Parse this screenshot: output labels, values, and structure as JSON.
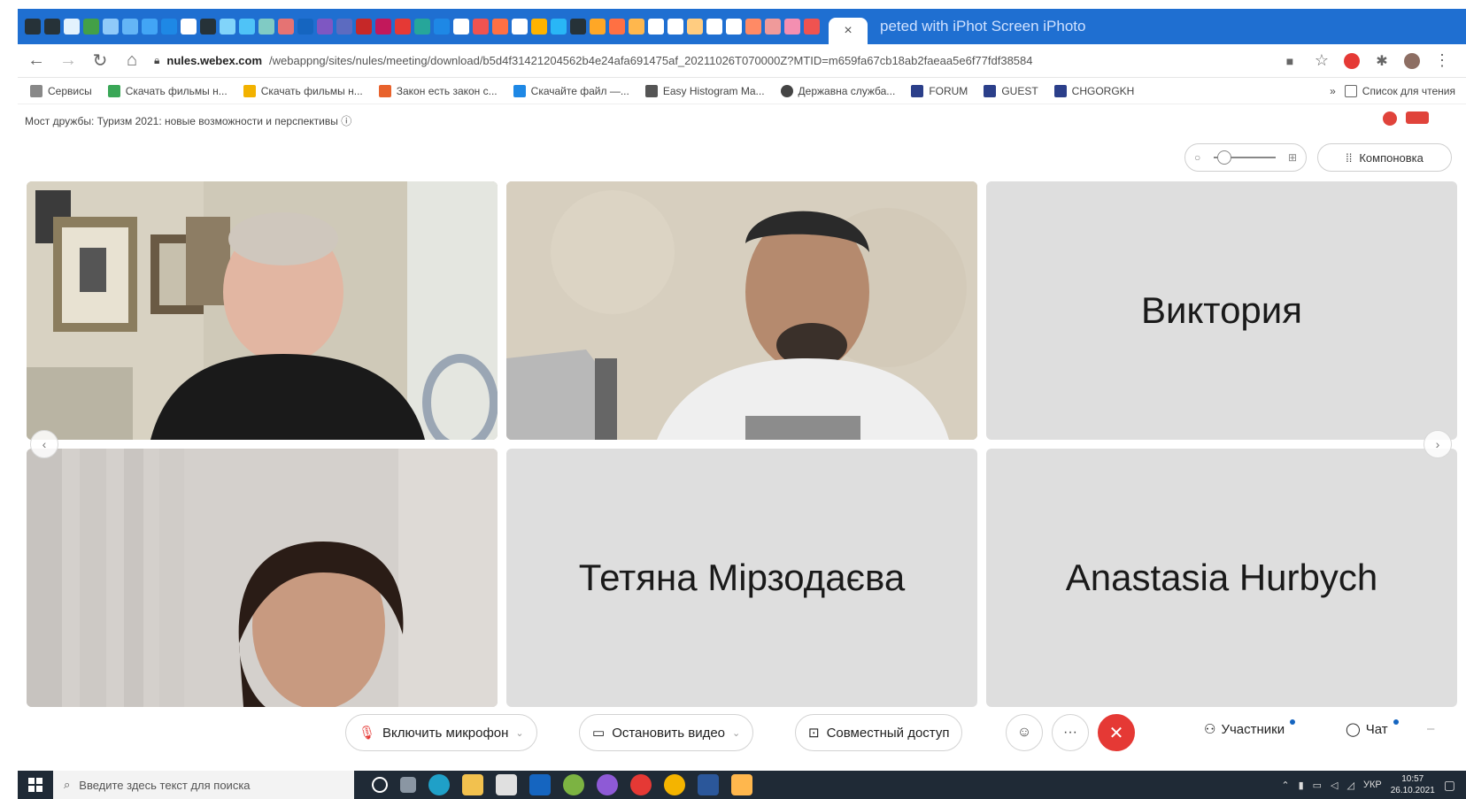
{
  "browser": {
    "tab_label": "peted with iPhot Screen iPhoto",
    "tab_close": "×",
    "url_host": "nules.webex.com",
    "url_path": "/webappng/sites/nules/meeting/download/b5d4f31421204562b4e24afa691475af_20211026T070000Z?MTID=m659fa67cb18ab2faeaa5e6f77fdf38584"
  },
  "bookmarks": [
    {
      "label": "Сервисы",
      "color": "#888888"
    },
    {
      "label": "Скачать фильмы н...",
      "color": "#3aa757"
    },
    {
      "label": "Скачать фильмы н...",
      "color": "#f2b200"
    },
    {
      "label": "Закон есть закон с...",
      "color": "#e8622c"
    },
    {
      "label": "Скачайте файл —...",
      "color": "#1e88e5"
    },
    {
      "label": "Easy Histogram Ma...",
      "color": "#555555"
    },
    {
      "label": "Державна служба...",
      "color": "#444444"
    },
    {
      "label": "FORUM",
      "color": "#2b3f8a"
    },
    {
      "label": "GUEST",
      "color": "#2b3f8a"
    },
    {
      "label": "CHGORGKH",
      "color": "#2b3f8a"
    }
  ],
  "bookmarks_more": "»",
  "reading_list": "Список для чтения",
  "meeting": {
    "title": "Мост дружбы: Туризм 2021: новые возможности и перспективы"
  },
  "layout_button": "Компоновка",
  "participants": {
    "viktoria": "Виктория",
    "tetyana": "Тетяна Мірзодаєва",
    "anastasia": "Anastasia Hurbych"
  },
  "controls": {
    "mic": "Включить микрофон",
    "video": "Остановить видео",
    "share": "Совместный доступ",
    "participants": "Участники",
    "chat": "Чат",
    "more": "···"
  },
  "taskbar": {
    "search_placeholder": "Введите здесь текст для поиска",
    "lang": "УКР",
    "time": "10:57",
    "date": "26.10.2021"
  },
  "colors": {
    "tab_strip": "#1f6fd1",
    "end_call": "#e53935",
    "tile_bg": "#dedede",
    "taskbar": "#1f2a36"
  }
}
